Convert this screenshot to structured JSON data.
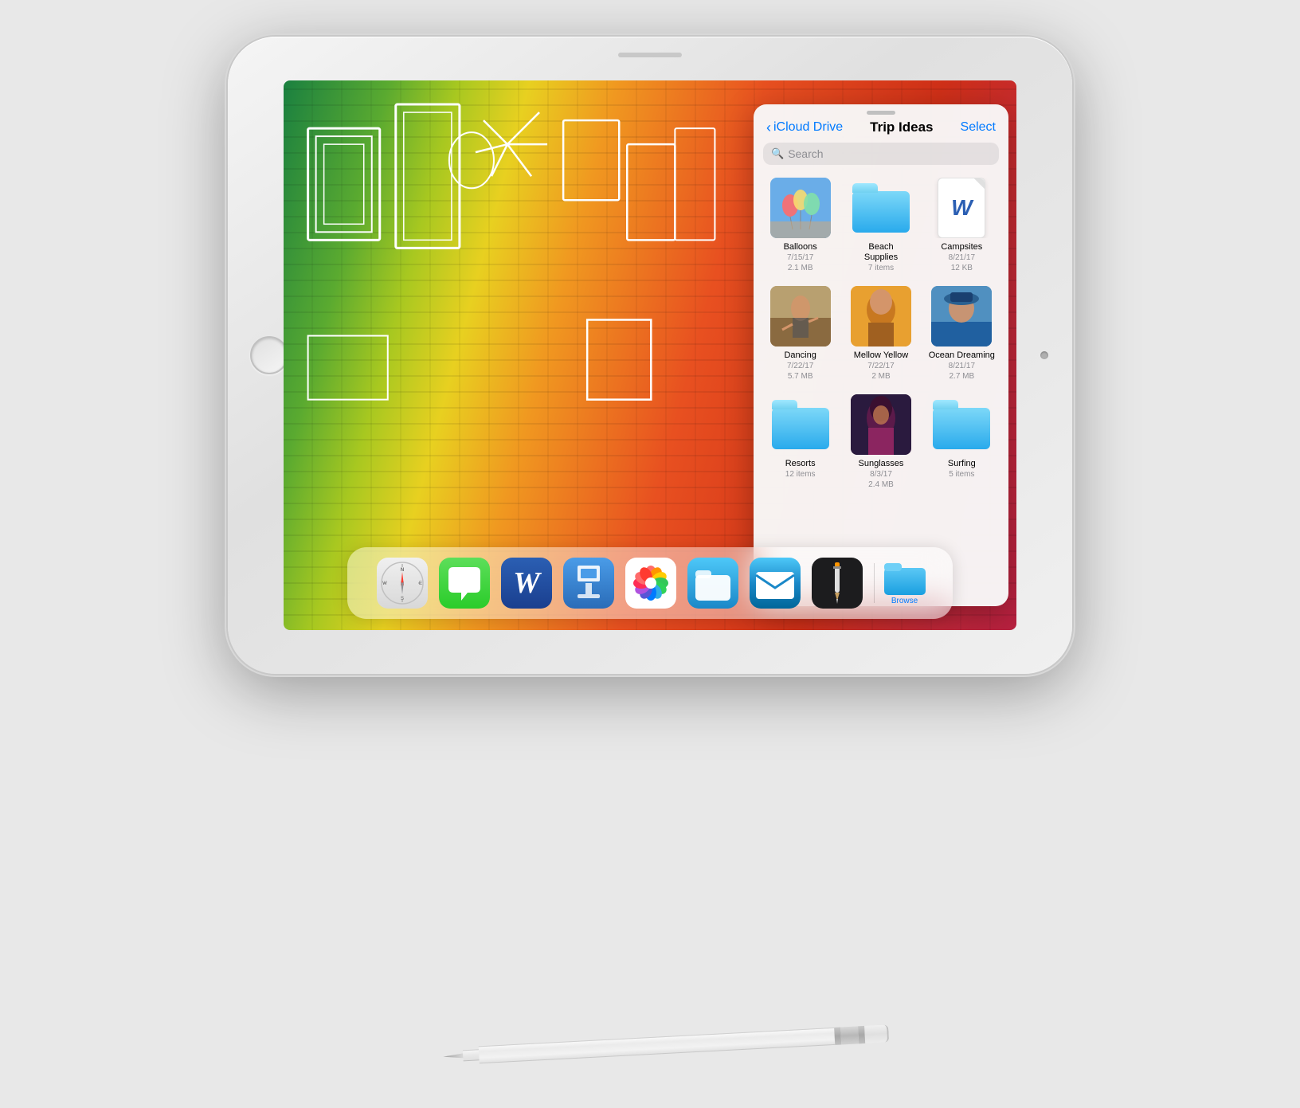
{
  "device": {
    "type": "iPad",
    "color": "silver"
  },
  "screen": {
    "files_panel": {
      "back_label": "iCloud Drive",
      "title": "Trip Ideas",
      "select_label": "Select",
      "search_placeholder": "Search",
      "items": [
        {
          "id": "balloons",
          "name": "Balloons",
          "type": "photo",
          "meta1": "7/15/17",
          "meta2": "2.1 MB"
        },
        {
          "id": "beach_supplies",
          "name": "Beach Supplies",
          "type": "folder",
          "meta1": "7 items",
          "meta2": ""
        },
        {
          "id": "campsites",
          "name": "Campsites",
          "type": "word",
          "meta1": "8/21/17",
          "meta2": "12 KB"
        },
        {
          "id": "dancing",
          "name": "Dancing",
          "type": "photo",
          "meta1": "7/22/17",
          "meta2": "5.7 MB"
        },
        {
          "id": "mellow_yellow",
          "name": "Mellow Yellow",
          "type": "photo",
          "meta1": "7/22/17",
          "meta2": "2 MB"
        },
        {
          "id": "ocean_dreaming",
          "name": "Ocean Dreaming",
          "type": "photo",
          "meta1": "8/21/17",
          "meta2": "2.7 MB"
        },
        {
          "id": "resorts",
          "name": "Resorts",
          "type": "folder",
          "meta1": "12 items",
          "meta2": ""
        },
        {
          "id": "sunglasses",
          "name": "Sunglasses",
          "type": "photo",
          "meta1": "8/3/17",
          "meta2": "2.4 MB"
        },
        {
          "id": "surfing",
          "name": "Surfing",
          "type": "folder",
          "meta1": "5 items",
          "meta2": ""
        }
      ]
    },
    "dock": {
      "apps": [
        {
          "id": "safari",
          "label": "Safari"
        },
        {
          "id": "messages",
          "label": "Messages"
        },
        {
          "id": "word",
          "label": "Microsoft Word"
        },
        {
          "id": "keynote",
          "label": "Keynote"
        },
        {
          "id": "photos",
          "label": "Photos"
        },
        {
          "id": "files",
          "label": "Files"
        },
        {
          "id": "mail",
          "label": "Mail"
        },
        {
          "id": "pencil_app",
          "label": "Pencil"
        },
        {
          "id": "browse",
          "label": "Browse"
        }
      ],
      "browse_label": "Browse"
    }
  },
  "pencil": {
    "label": "Apple Pencil"
  }
}
